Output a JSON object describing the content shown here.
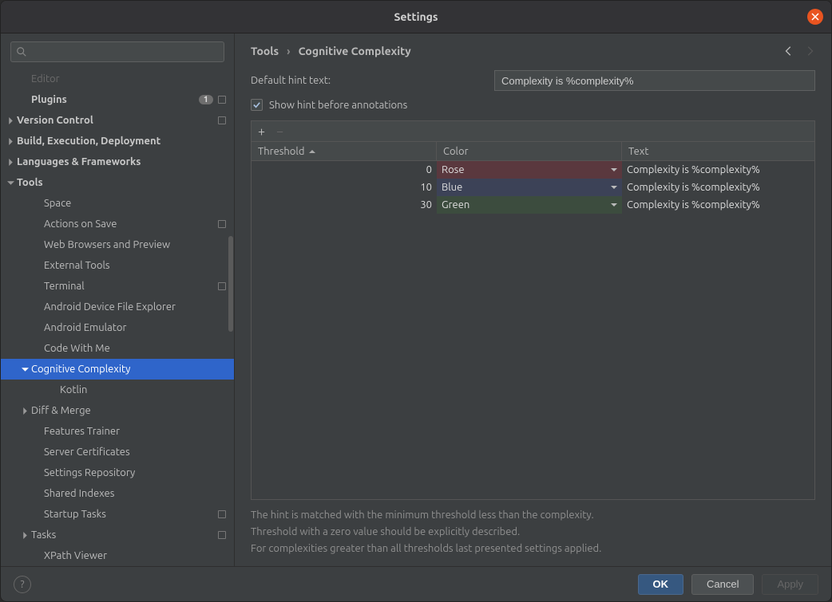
{
  "window": {
    "title": "Settings"
  },
  "search": {
    "placeholder": ""
  },
  "sidebar": {
    "items": [
      {
        "label": "Editor",
        "indent": 1,
        "expand": "none",
        "faded": true
      },
      {
        "label": "Plugins",
        "indent": 1,
        "bold": true,
        "badge": "1",
        "cfg": true
      },
      {
        "label": "Version Control",
        "indent": 0,
        "expand": "right",
        "bold": true,
        "cfg": true
      },
      {
        "label": "Build, Execution, Deployment",
        "indent": 0,
        "expand": "right",
        "bold": true
      },
      {
        "label": "Languages & Frameworks",
        "indent": 0,
        "expand": "right",
        "bold": true
      },
      {
        "label": "Tools",
        "indent": 0,
        "expand": "down",
        "bold": true
      },
      {
        "label": "Space",
        "indent": 2
      },
      {
        "label": "Actions on Save",
        "indent": 2,
        "cfg": true
      },
      {
        "label": "Web Browsers and Preview",
        "indent": 2
      },
      {
        "label": "External Tools",
        "indent": 2
      },
      {
        "label": "Terminal",
        "indent": 2,
        "cfg": true
      },
      {
        "label": "Android Device File Explorer",
        "indent": 2
      },
      {
        "label": "Android Emulator",
        "indent": 2
      },
      {
        "label": "Code With Me",
        "indent": 2
      },
      {
        "label": "Cognitive Complexity",
        "indent": 1,
        "expand": "down",
        "selected": true
      },
      {
        "label": "Kotlin",
        "indent": 3
      },
      {
        "label": "Diff & Merge",
        "indent": 1,
        "expand": "right"
      },
      {
        "label": "Features Trainer",
        "indent": 2
      },
      {
        "label": "Server Certificates",
        "indent": 2
      },
      {
        "label": "Settings Repository",
        "indent": 2
      },
      {
        "label": "Shared Indexes",
        "indent": 2
      },
      {
        "label": "Startup Tasks",
        "indent": 2,
        "cfg": true
      },
      {
        "label": "Tasks",
        "indent": 1,
        "expand": "right",
        "cfg": true
      },
      {
        "label": "XPath Viewer",
        "indent": 2
      }
    ]
  },
  "breadcrumb": {
    "parent": "Tools",
    "current": "Cognitive Complexity"
  },
  "form": {
    "default_hint_label": "Default hint text:",
    "default_hint_value": "Complexity is %complexity%",
    "show_hint_label": "Show hint before annotations",
    "show_hint_checked": true
  },
  "table": {
    "headers": {
      "threshold": "Threshold",
      "color": "Color",
      "text": "Text"
    },
    "rows": [
      {
        "threshold": "0",
        "color": "Rose",
        "color_class": "color-rose",
        "text": "Complexity is %complexity%"
      },
      {
        "threshold": "10",
        "color": "Blue",
        "color_class": "color-blue",
        "text": "Complexity is %complexity%"
      },
      {
        "threshold": "30",
        "color": "Green",
        "color_class": "color-green",
        "text": "Complexity is %complexity%"
      }
    ]
  },
  "help": {
    "line1": "The hint is matched with the minimum threshold less than the complexity.",
    "line2": "Threshold with a zero value should be explicitly described.",
    "line3": "For complexities greater than all thresholds last presented settings applied."
  },
  "footer": {
    "ok": "OK",
    "cancel": "Cancel",
    "apply": "Apply"
  }
}
